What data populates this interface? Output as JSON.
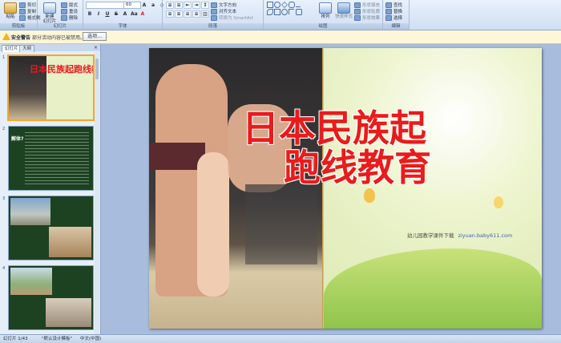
{
  "ribbon": {
    "clipboard": {
      "label": "剪贴板",
      "paste": "粘贴",
      "cut": "剪切",
      "copy": "复制",
      "format_painter": "格式刷"
    },
    "slides": {
      "label": "幻灯片",
      "new_slide": "新建\n幻灯片",
      "layout": "版式",
      "reset": "重设",
      "delete": "删除"
    },
    "font": {
      "label": "字体",
      "size": "60",
      "buttons": [
        "B",
        "I",
        "U",
        "S",
        "A",
        "Aa",
        "A"
      ]
    },
    "paragraph": {
      "label": "段落",
      "text_direction": "文字方向",
      "align_text": "对齐文本",
      "smartart": "转换为 SmartArt"
    },
    "drawing": {
      "label": "绘图",
      "arrange": "排列",
      "quick_styles": "快速样式",
      "shape_fill": "形状填充",
      "shape_outline": "形状轮廓",
      "shape_effects": "形状效果"
    },
    "editing": {
      "label": "编辑",
      "find": "查找",
      "replace": "替换",
      "select": "选择"
    }
  },
  "security": {
    "title": "安全警告",
    "message": "部分活动内容已被禁用。",
    "options": "选项..."
  },
  "panel": {
    "tab_slides": "幻灯片",
    "tab_outline": "大纲",
    "close": "×",
    "thumbnails": [
      {
        "num": "1",
        "title": "日本民族起跑线教育"
      },
      {
        "num": "2",
        "heading": "解体?"
      },
      {
        "num": "3"
      },
      {
        "num": "4"
      }
    ]
  },
  "slide": {
    "title_line1": "日本民族起",
    "title_line2": "跑线教育",
    "credit": "幼儿园教学课件下载",
    "url": "ziyuan.baby611.com"
  },
  "status": {
    "slide_info": "幻灯片 1/43",
    "theme": "\"默认设计模板\"",
    "language": "中文(中国)"
  },
  "colors": {
    "title_red": "#ea1b1b",
    "accent_gold": "#f1a72d",
    "thumb_green": "#1d4221"
  }
}
